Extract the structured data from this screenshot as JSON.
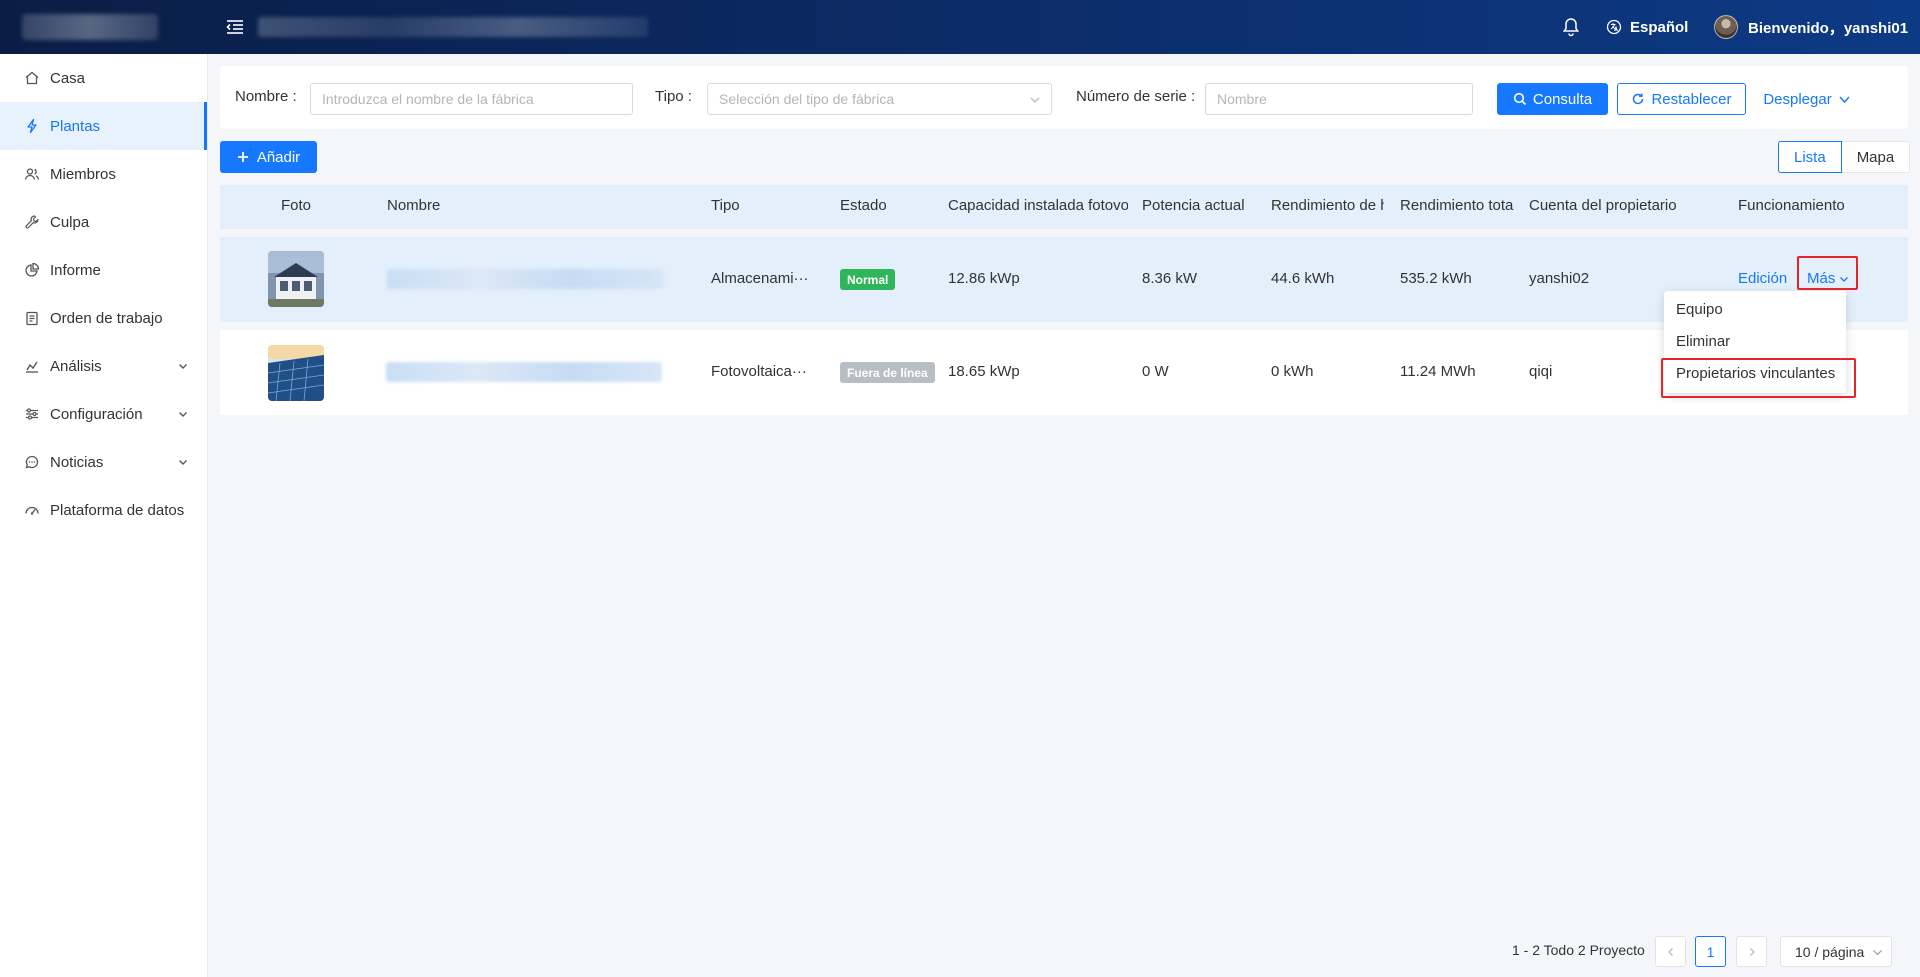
{
  "header": {
    "language": "Español",
    "welcome": "Bienvenido，yanshi01"
  },
  "sidebar": {
    "items": [
      {
        "label": "Casa",
        "icon": "home-icon"
      },
      {
        "label": "Plantas",
        "icon": "lightning-icon",
        "active": true
      },
      {
        "label": "Miembros",
        "icon": "users-icon"
      },
      {
        "label": "Culpa",
        "icon": "wrench-icon"
      },
      {
        "label": "Informe",
        "icon": "pie-chart-icon"
      },
      {
        "label": "Orden de trabajo",
        "icon": "clipboard-icon"
      },
      {
        "label": "Análisis",
        "icon": "bar-chart-icon",
        "expandable": true
      },
      {
        "label": "Configuración",
        "icon": "sliders-icon",
        "expandable": true
      },
      {
        "label": "Noticias",
        "icon": "chat-icon",
        "expandable": true
      },
      {
        "label": "Plataforma de datos",
        "icon": "dashboard-icon"
      }
    ]
  },
  "filters": {
    "name_label": "Nombre :",
    "name_placeholder": "Introduzca el nombre de la fábrica",
    "type_label": "Tipo :",
    "type_placeholder": "Selección del tipo de fábrica",
    "serial_label": "Número de serie :",
    "serial_placeholder": "Nombre",
    "search_button": "Consulta",
    "reset_button": "Restablecer",
    "expand_button": "Desplegar"
  },
  "toolbar": {
    "add_button": "Añadir",
    "view_list": "Lista",
    "view_map": "Mapa"
  },
  "table": {
    "columns": [
      "Foto",
      "Nombre",
      "Tipo",
      "Estado",
      "Capacidad instalada fotovo",
      "Potencia actual",
      "Rendimiento de h",
      "Rendimiento tota",
      "Cuenta del propietario",
      "Funcionamiento"
    ],
    "rows": [
      {
        "type": "Almacenami···",
        "status": "Normal",
        "capacity": "12.86 kWp",
        "power": "8.36 kW",
        "yield_day": "44.6 kWh",
        "yield_total": "535.2 kWh",
        "owner": "yanshi02"
      },
      {
        "type": "Fotovoltaica···",
        "status": "Fuera de línea",
        "capacity": "18.65 kWp",
        "power": "0 W",
        "yield_day": "0 kWh",
        "yield_total": "11.24 MWh",
        "owner": "qiqi"
      }
    ],
    "edit_link": "Edición",
    "more_link": "Más"
  },
  "more_menu": {
    "items": [
      "Equipo",
      "Eliminar",
      "Propietarios vinculantes"
    ]
  },
  "pagination": {
    "total_text": "1 - 2 Todo 2 Proyecto",
    "current_page": "1",
    "page_size": "10 / página"
  },
  "colors": {
    "primary": "#1677ff",
    "status_normal": "#2fb55a",
    "status_offline": "#b8bec6",
    "highlight": "#e5252a"
  }
}
